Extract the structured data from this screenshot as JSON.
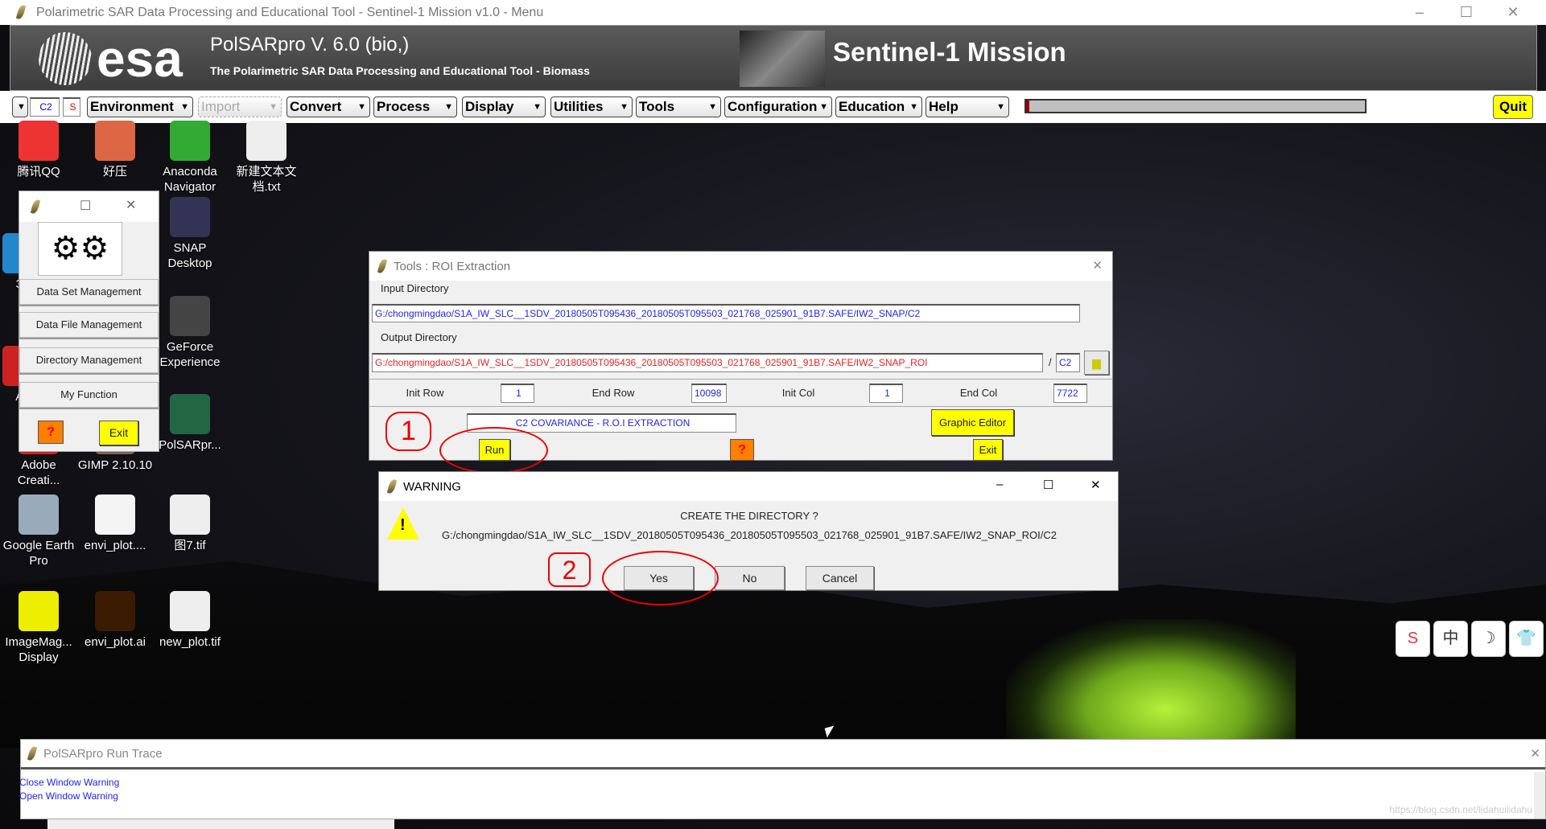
{
  "main_window": {
    "title": "Polarimetric SAR Data Processing and Educational Tool - Sentinel-1 Mission v1.0 - Menu",
    "controls": {
      "minimize": "–",
      "maximize": "☐",
      "close": "✕"
    },
    "banner": {
      "logo": "esa",
      "product": "PolSARpro V. 6.0 (bio,)",
      "subtitle": "The Polarimetric SAR Data Processing and Educational Tool - Biomass",
      "mission": "Sentinel-1 Mission"
    },
    "menu": {
      "mode": "C2",
      "flag": "S",
      "items": [
        "Environment",
        "Import",
        "Convert",
        "Process",
        "Display",
        "Utilities",
        "Tools",
        "Configuration",
        "Education",
        "Help"
      ],
      "progress_percent": 1,
      "quit": "Quit"
    }
  },
  "desktop_icons": [
    {
      "label": "腾讯QQ",
      "color": "#e33"
    },
    {
      "label": "好压",
      "color": "#d64"
    },
    {
      "label": "Anaconda Navigator",
      "color": "#3a3"
    },
    {
      "label": "新建文本文档.txt",
      "color": "#eee"
    },
    {
      "label": "SNAP Desktop",
      "color": "#335"
    },
    {
      "label": "GeForce Experience",
      "color": "#444"
    },
    {
      "label": "PolSARpr...",
      "color": "#264"
    },
    {
      "label": "Google Earth Pro",
      "color": "#9ab"
    },
    {
      "label": "envi_plot....",
      "color": "#f4f4f4"
    },
    {
      "label": "图7.tif",
      "color": "#eee"
    },
    {
      "label": "ImageMag... Display",
      "color": "#ee0"
    },
    {
      "label": "envi_plot.ai",
      "color": "#3a1a00"
    },
    {
      "label": "new_plot.tif",
      "color": "#eee"
    },
    {
      "label": "36",
      "color": "#28c"
    },
    {
      "label": "Ac",
      "color": "#c22"
    },
    {
      "label": "Adobe Creati...",
      "color": "#c22"
    },
    {
      "label": "GIMP 2.10.10",
      "color": "#765"
    }
  ],
  "tools_window": {
    "buttons": [
      "Data Set Management",
      "Data File Management",
      "Directory Management",
      "My Function"
    ],
    "help": "?",
    "exit": "Exit"
  },
  "roi_dialog": {
    "title": "Tools : ROI Extraction",
    "input_label": "Input Directory",
    "input_dir": "G:/chongmingdao/S1A_IW_SLC__1SDV_20180505T095436_20180505T095503_021768_025901_91B7.SAFE/IW2_SNAP/C2",
    "output_label": "Output Directory",
    "output_dir": "G:/chongmingdao/S1A_IW_SLC__1SDV_20180505T095436_20180505T095503_021768_025901_91B7.SAFE/IW2_SNAP_ROI",
    "separator": "/",
    "output_sub": "C2",
    "init_row_label": "Init Row",
    "init_row": "1",
    "end_row_label": "End Row",
    "end_row": "10098",
    "init_col_label": "Init Col",
    "init_col": "1",
    "end_col_label": "End Col",
    "end_col": "7722",
    "mode_text": "C2 COVARIANCE - R.O.I EXTRACTION",
    "graphic_editor": "Graphic Editor",
    "run": "Run",
    "help": "?",
    "exit": "Exit",
    "close": "✕",
    "annotation": "1"
  },
  "warning_dialog": {
    "title": "WARNING",
    "message": "CREATE THE DIRECTORY ?",
    "path": "G:/chongmingdao/S1A_IW_SLC__1SDV_20180505T095436_20180505T095503_021768_025901_91B7.SAFE/IW2_SNAP_ROI/C2",
    "yes": "Yes",
    "no": "No",
    "cancel": "Cancel",
    "annotation": "2",
    "controls": {
      "minimize": "–",
      "maximize": "☐",
      "close": "✕"
    }
  },
  "run_trace": {
    "title": "PolSARpro Run Trace",
    "lines": [
      "Close Window Warning",
      "Open Window Warning"
    ],
    "close": "✕"
  },
  "ime_toolbar": [
    "S",
    "中",
    "☽",
    "👕"
  ],
  "watermark": "https://blog.csdn.net/lidahuilidahu"
}
